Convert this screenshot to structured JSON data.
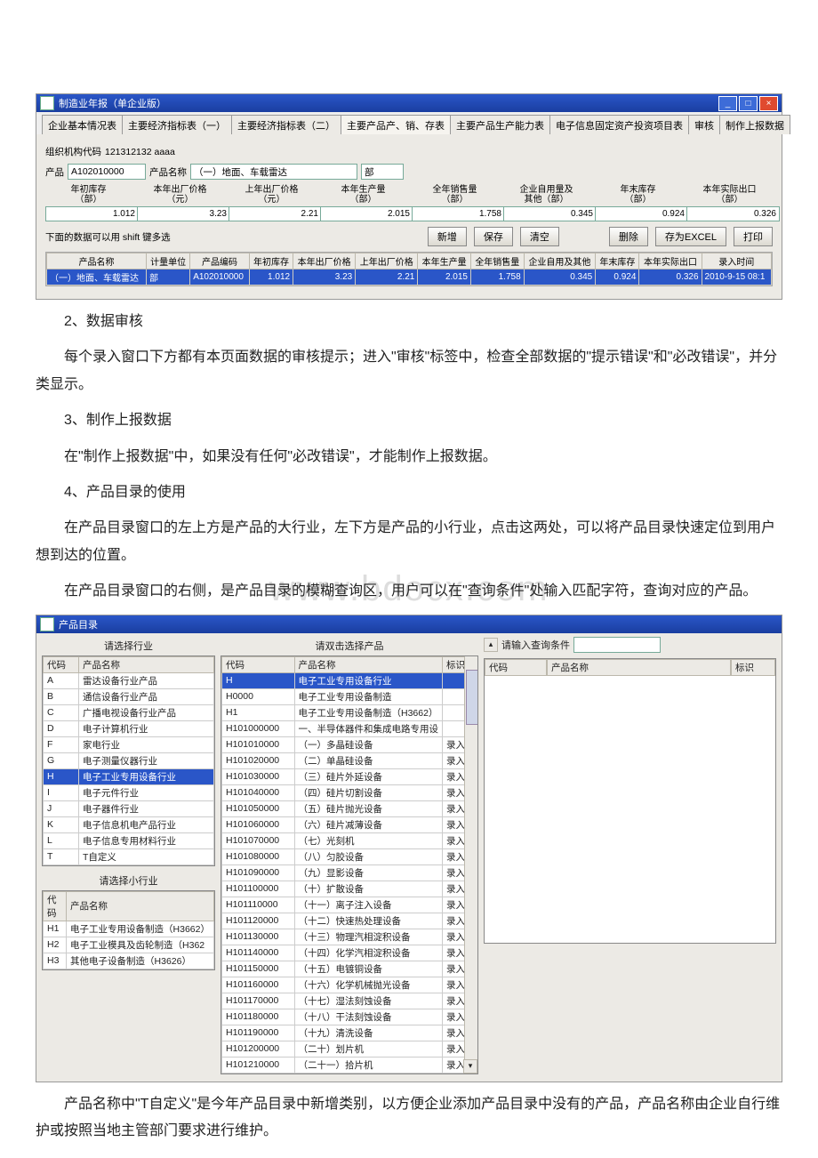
{
  "win1": {
    "title": "制造业年报（单企业版）",
    "tabs": [
      "企业基本情况表",
      "主要经济指标表（一）",
      "主要经济指标表（二）",
      "主要产品产、销、存表",
      "主要产品生产能力表",
      "电子信息固定资产投资项目表",
      "审核",
      "制作上报数据"
    ],
    "active_tab_index": 3,
    "org_label": "组织机构代码",
    "org_code": "121312132    aaaa",
    "prod_label": "产品",
    "prod_code": "A102010000",
    "prod_name_label": "产品名称",
    "prod_name": "（一）地面、车载雷达",
    "unit": "部",
    "fields": [
      {
        "hdr": "年初库存\n（部）",
        "val": "1.012"
      },
      {
        "hdr": "本年出厂价格\n（元）",
        "val": "3.23"
      },
      {
        "hdr": "上年出厂价格\n（元）",
        "val": "2.21"
      },
      {
        "hdr": "本年生产量\n（部）",
        "val": "2.015"
      },
      {
        "hdr": "全年销售量\n（部）",
        "val": "1.758"
      },
      {
        "hdr": "企业自用量及\n其他（部）",
        "val": "0.345"
      },
      {
        "hdr": "年末库存\n（部）",
        "val": "0.924"
      },
      {
        "hdr": "本年实际出口\n（部）",
        "val": "0.326"
      }
    ],
    "tip": "下面的数据可以用 shift 键多选",
    "btns": {
      "add": "新增",
      "save": "保存",
      "clear": "清空",
      "del": "删除",
      "excel": "存为EXCEL",
      "print": "打印"
    },
    "grid_headers": [
      "产品名称",
      "计量单位",
      "产品编码",
      "年初库存",
      "本年出厂价格",
      "上年出厂价格",
      "本年生产量",
      "全年销售量",
      "企业自用及其他",
      "年末库存",
      "本年实际出口",
      "录入时间"
    ],
    "grid_row": [
      "（一）地面、车载雷达",
      "部",
      "A102010000",
      "1.012",
      "3.23",
      "2.21",
      "2.015",
      "1.758",
      "0.345",
      "0.924",
      "0.326",
      "2010-9-15 08:1"
    ]
  },
  "para_s2": "2、数据审核",
  "para_p2": "每个录入窗口下方都有本页面数据的审核提示；进入\"审核\"标签中，检查全部数据的\"提示错误\"和\"必改错误\"，并分类显示。",
  "para_s3": "3、制作上报数据",
  "para_p3": "在\"制作上报数据\"中，如果没有任何\"必改错误\"，才能制作上报数据。",
  "para_s4": "4、产品目录的使用",
  "para_p4a": "在产品目录窗口的左上方是产品的大行业，左下方是产品的小行业，点击这两处，可以将产品目录快速定位到用户想到达的位置。",
  "para_p4b": "在产品目录窗口的右侧，是产品目录的模糊查询区，用户可以在\"查询条件\"处输入匹配字符，查询对应的产品。",
  "watermark": "www.bdocx.com",
  "win2": {
    "title": "产品目录",
    "left_head": "请选择行业",
    "mid_head": "请双击选择产品",
    "left_top_headers": [
      "代码",
      "产品名称"
    ],
    "left_top_rows": [
      [
        "A",
        "雷达设备行业产品"
      ],
      [
        "B",
        "通信设备行业产品"
      ],
      [
        "C",
        "广播电视设备行业产品"
      ],
      [
        "D",
        "电子计算机行业"
      ],
      [
        "F",
        "家电行业"
      ],
      [
        "G",
        "电子测量仪器行业"
      ],
      [
        "H",
        "电子工业专用设备行业"
      ],
      [
        "I",
        "电子元件行业"
      ],
      [
        "J",
        "电子器件行业"
      ],
      [
        "K",
        "电子信息机电产品行业"
      ],
      [
        "L",
        "电子信息专用材料行业"
      ],
      [
        "T",
        "T自定义"
      ]
    ],
    "left_top_sel": 6,
    "left_bot_head": "请选择小行业",
    "left_bot_headers": [
      "代码",
      "产品名称"
    ],
    "left_bot_rows": [
      [
        "H1",
        "电子工业专用设备制造（H3662）"
      ],
      [
        "H2",
        "电子工业模具及齿轮制造（H362"
      ],
      [
        "H3",
        "其他电子设备制造（H3626）"
      ]
    ],
    "mid_headers": [
      "代码",
      "产品名称",
      "标识"
    ],
    "mid_rows": [
      [
        "H",
        "电子工业专用设备行业",
        ""
      ],
      [
        "H0000",
        "电子工业专用设备制造",
        ""
      ],
      [
        "H1",
        "电子工业专用设备制造（H3662）",
        ""
      ],
      [
        "H101000000",
        "一、半导体器件和集成电路专用设",
        ""
      ],
      [
        "H101010000",
        "（一）多晶硅设备",
        "录入"
      ],
      [
        "H101020000",
        "（二）单晶硅设备",
        "录入"
      ],
      [
        "H101030000",
        "（三）硅片外延设备",
        "录入"
      ],
      [
        "H101040000",
        "（四）硅片切割设备",
        "录入"
      ],
      [
        "H101050000",
        "（五）硅片抛光设备",
        "录入"
      ],
      [
        "H101060000",
        "（六）硅片减薄设备",
        "录入"
      ],
      [
        "H101070000",
        "（七）光刻机",
        "录入"
      ],
      [
        "H101080000",
        "（八）匀胶设备",
        "录入"
      ],
      [
        "H101090000",
        "（九）显影设备",
        "录入"
      ],
      [
        "H101100000",
        "（十）扩散设备",
        "录入"
      ],
      [
        "H101110000",
        "（十一）离子注入设备",
        "录入"
      ],
      [
        "H101120000",
        "（十二）快速热处理设备",
        "录入"
      ],
      [
        "H101130000",
        "（十三）物理汽相淀积设备",
        "录入"
      ],
      [
        "H101140000",
        "（十四）化学汽相淀积设备",
        "录入"
      ],
      [
        "H101150000",
        "（十五）电镀铜设备",
        "录入"
      ],
      [
        "H101160000",
        "（十六）化学机械抛光设备",
        "录入"
      ],
      [
        "H101170000",
        "（十七）湿法刻蚀设备",
        "录入"
      ],
      [
        "H101180000",
        "（十八）干法刻蚀设备",
        "录入"
      ],
      [
        "H101190000",
        "（十九）清洗设备",
        "录入"
      ],
      [
        "H101200000",
        "（二十）划片机",
        "录入"
      ],
      [
        "H101210000",
        "（二十一）拾片机",
        "录入"
      ]
    ],
    "mid_sel": 0,
    "right_label": "请输入查询条件",
    "right_headers": [
      "代码",
      "产品名称",
      "标识"
    ]
  },
  "para_last": "产品名称中\"T自定义\"是今年产品目录中新增类别，以方便企业添加产品目录中没有的产品，产品名称由企业自行维护或按照当地主管部门要求进行维护。"
}
